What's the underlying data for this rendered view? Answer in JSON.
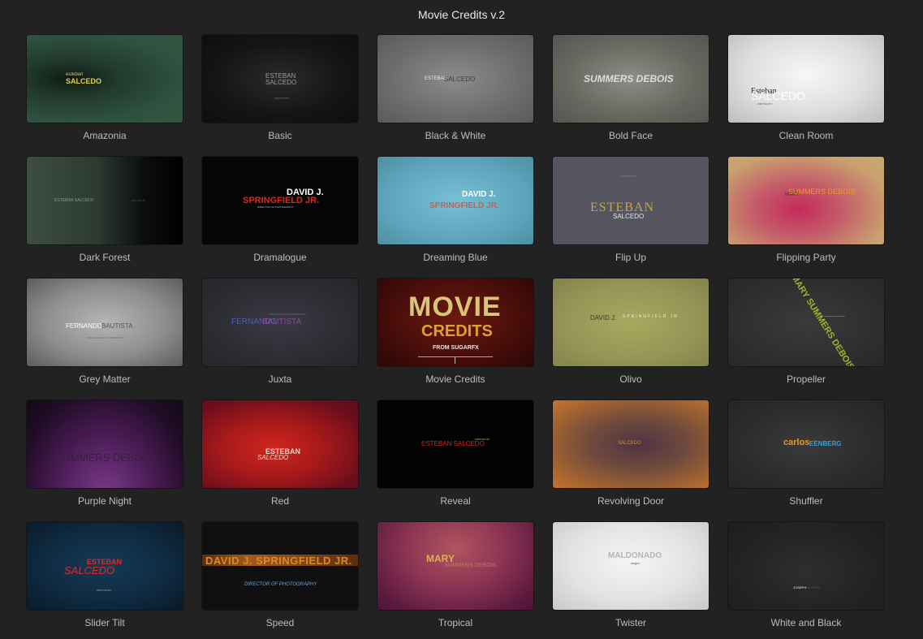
{
  "window": {
    "title": "Movie Credits v.2"
  },
  "templates": [
    {
      "label": "Amazonia",
      "preview": {
        "l1": "esteban",
        "l2": "SALCEDO"
      }
    },
    {
      "label": "Basic",
      "preview": {
        "l1": "ESTEBAN",
        "l2": "SALCEDO",
        "l3": "WRITTEN BY"
      }
    },
    {
      "label": "Black & White",
      "preview": {
        "l1": "ESTEBAN",
        "l2": "SALCEDO"
      }
    },
    {
      "label": "Bold Face",
      "preview": {
        "l1": "SUMMERS DEBOIS"
      }
    },
    {
      "label": "Clean Room",
      "preview": {
        "l1": "Esteban",
        "l2": "SALCEDO",
        "l3": "WRITTEN BY"
      }
    },
    {
      "label": "Dark Forest",
      "preview": {
        "l1": "ESTEBAN SALCEDO",
        "l2": "WRITTEN BY"
      }
    },
    {
      "label": "Dramalogue",
      "preview": {
        "l1": "DAVID J.",
        "l2": "SPRINGFIELD JR.",
        "l3": "DIRECTOR OF PHOTOGRAPHY"
      }
    },
    {
      "label": "Dreaming Blue",
      "preview": {
        "l1": "DAVID J.",
        "l2": "SPRINGFIELD JR."
      }
    },
    {
      "label": "Flip Up",
      "preview": {
        "l1": "WRITTEN BY",
        "l2": "ESTEBAN",
        "l3": "SALCEDO"
      }
    },
    {
      "label": "Flipping Party",
      "preview": {
        "l1": "MARY",
        "l2": "SUMMERS DEBOIS"
      }
    },
    {
      "label": "Grey Matter",
      "preview": {
        "l1": "FERNANDO",
        "l2": "BAUTISTA",
        "l3": "VISUAL EFFECTS SUPERVISOR"
      }
    },
    {
      "label": "Juxta",
      "preview": {
        "l1": "FERNANDO",
        "l2": "BAUTISTA",
        "l3": "VISUAL EFFECTS SUPERVISOR"
      }
    },
    {
      "label": "Movie Credits",
      "preview": {
        "l1": "MOVIE",
        "l2": "CREDITS",
        "l3": "FROM SUGARFX"
      }
    },
    {
      "label": "Olivo",
      "preview": {
        "l1": "DAVID J.",
        "l2": "SPRINGFIELD JR."
      }
    },
    {
      "label": "Propeller",
      "preview": {
        "l1": "MARY SUMMERS DEBOIS"
      }
    },
    {
      "label": "Purple Night",
      "preview": {
        "l1": "MARY",
        "l2": "SUMMERS DEBOIS"
      }
    },
    {
      "label": "Red",
      "preview": {
        "l1": "ESTEBAN",
        "l2": "SALCEDO"
      }
    },
    {
      "label": "Reveal",
      "preview": {
        "l1": "ESTEBAN SALCEDO",
        "l2": "WRITTEN BY"
      }
    },
    {
      "label": "Revolving Door",
      "preview": {
        "l1": "SALCEDO"
      }
    },
    {
      "label": "Shuffler",
      "preview": {
        "l1": "carlos",
        "l2": "EENBERG"
      }
    },
    {
      "label": "Slider Tilt",
      "preview": {
        "l1": "ESTEBAN",
        "l2": "SALCEDO",
        "l3": "WRITTEN BY"
      }
    },
    {
      "label": "Speed",
      "preview": {
        "l1": "DAVID J. SPRINGFIELD JR.",
        "l2": "DIRECTOR OF PHOTOGRAPHY"
      }
    },
    {
      "label": "Tropical",
      "preview": {
        "l1": "MARY",
        "l2": "SUMMERS DEBOIS"
      }
    },
    {
      "label": "Twister",
      "preview": {
        "l1": "MALDONADO",
        "l2": "singer"
      }
    },
    {
      "label": "White and Black",
      "preview": {
        "l1": "JOSEPH",
        "l2": "BARSON"
      }
    }
  ]
}
